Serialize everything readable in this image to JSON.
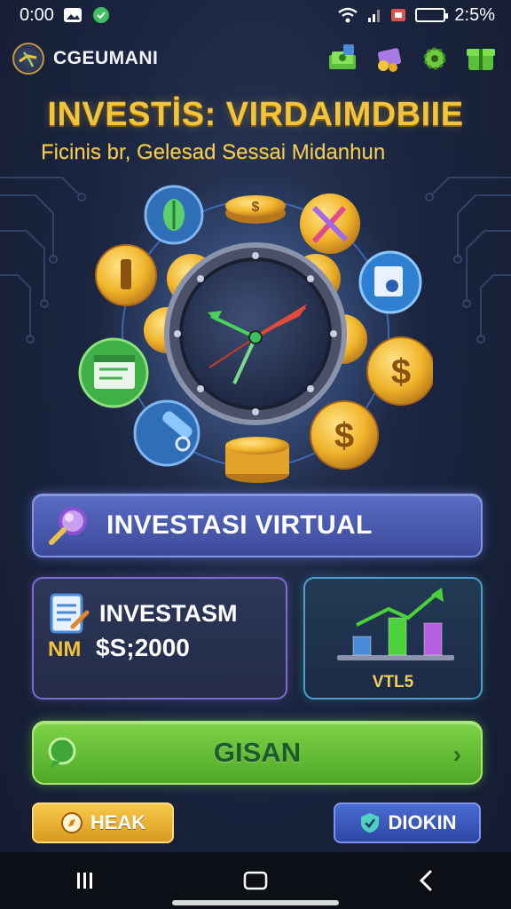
{
  "status_bar": {
    "time": "0:00",
    "clock_right": "2:5%",
    "icons": [
      "image-icon",
      "chat-bubble-icon",
      "wifi-icon",
      "signal-icon",
      "notification-icon",
      "battery-icon"
    ]
  },
  "header": {
    "brand_name": "CGEUMANI",
    "icons": [
      "money-stack-icon",
      "gift-icon",
      "settings-gear-icon",
      "gift-box-icon"
    ]
  },
  "title": "INVESTİS: VIRDAIMDBIIE",
  "subtitle": "Ficinis br, Gelesad Sessai Midanhun",
  "colors": {
    "title_gold": "#f3c43a",
    "primary_blue": "#3b4a9a",
    "success_green": "#4fa926",
    "warning_orange": "#d99a1f",
    "chart_green": "#4bd23a",
    "chart_purple": "#b45fe0",
    "chart_blue": "#4a8cd8"
  },
  "hero": {
    "center_icon": "compass-dial-icon",
    "orbit_icons": [
      "coin-dollar-icon",
      "leaf-coin-icon",
      "coin-icon",
      "tools-icon",
      "document-icon",
      "browser-window-icon",
      "brush-icon"
    ]
  },
  "buttons": {
    "virtual_label": "INVESTASI VIRTUAL",
    "gisan_label": "GISAN",
    "heak_label": "HEAK",
    "diokin_label": "DIOKIN"
  },
  "info_card": {
    "name": "INVESTASM",
    "currency_prefix": "NM",
    "amount": "$S;2000"
  },
  "chart_card": {
    "caption": "VTL5",
    "bars": [
      0.35,
      0.7,
      0.6
    ],
    "arrow": "trend-up-icon"
  },
  "nav": {
    "items": [
      "recent-apps-icon",
      "home-icon",
      "back-icon"
    ]
  }
}
